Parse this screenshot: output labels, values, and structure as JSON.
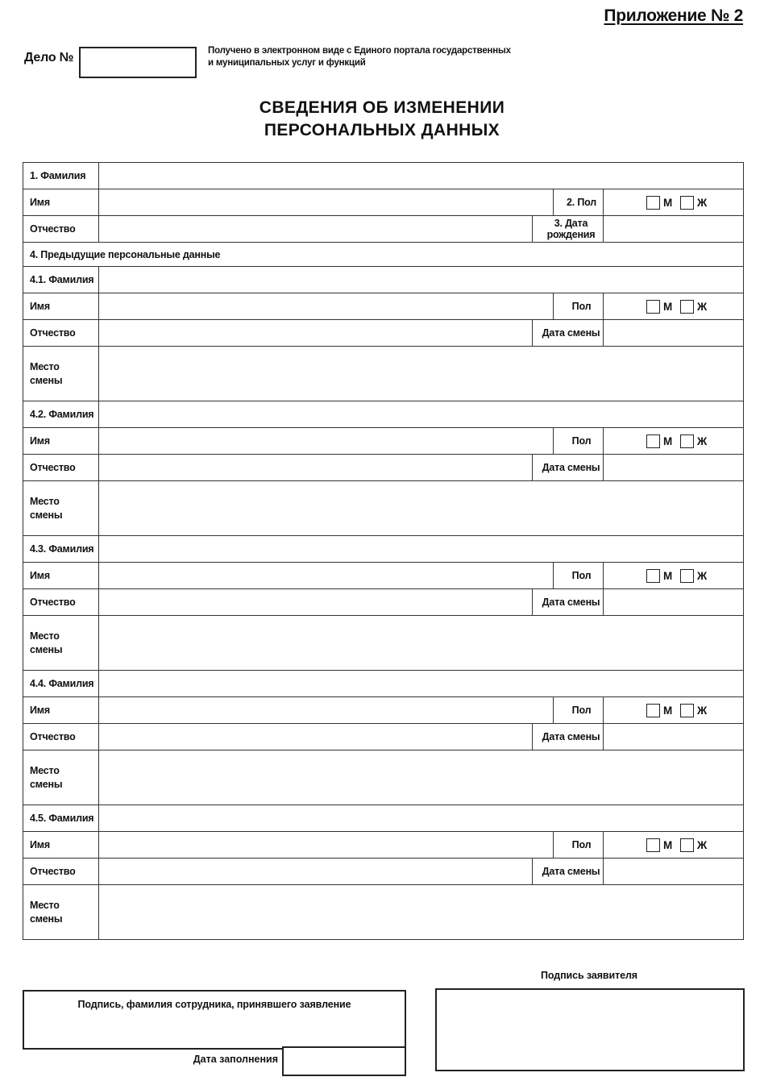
{
  "header": {
    "appendix": "Приложение № 2",
    "case_label": "Дело №",
    "case_value": "",
    "portal_note_line1": "Получено в электронном виде с Единого портала",
    "portal_note_line2": "государственных и муниципальных услуг и функций"
  },
  "title": {
    "line1": "СВЕДЕНИЯ ОБ ИЗМЕНЕНИИ",
    "line2": "ПЕРСОНАЛЬНЫХ ДАННЫХ"
  },
  "current": {
    "surname_label": "1. Фамилия",
    "surname_value": "",
    "firstname_label": "Имя",
    "firstname_value": "",
    "patronymic_label": "Отчество",
    "patronymic_value": "",
    "sex_label": "2. Пол",
    "sex_male": "М",
    "sex_female": "Ж",
    "dob_label": "3. Дата рождения",
    "dob_value": ""
  },
  "previous_section": {
    "heading": "4. Предыдущие персональные данные",
    "sex_label": "Пол",
    "sex_male": "М",
    "sex_female": "Ж",
    "date_change_label": "Дата смены",
    "firstname_label": "Имя",
    "patronymic_label": "Отчество",
    "place_label_line1": "Место",
    "place_label_line2": "смены",
    "blocks": [
      {
        "surname_label": "4.1. Фамилия",
        "surname_value": "",
        "firstname_value": "",
        "patronymic_value": "",
        "date_change_value": "",
        "place_value": ""
      },
      {
        "surname_label": "4.2. Фамилия",
        "surname_value": "",
        "firstname_value": "",
        "patronymic_value": "",
        "date_change_value": "",
        "place_value": ""
      },
      {
        "surname_label": "4.3. Фамилия",
        "surname_value": "",
        "firstname_value": "",
        "patronymic_value": "",
        "date_change_value": "",
        "place_value": ""
      },
      {
        "surname_label": "4.4. Фамилия",
        "surname_value": "",
        "firstname_value": "",
        "patronymic_value": "",
        "date_change_value": "",
        "place_value": ""
      },
      {
        "surname_label": "4.5. Фамилия",
        "surname_value": "",
        "firstname_value": "",
        "patronymic_value": "",
        "date_change_value": "",
        "place_value": ""
      }
    ]
  },
  "footer": {
    "staff_signature_label": "Подпись, фамилия сотрудника, принявшего заявление",
    "staff_signature_value": "",
    "fill_date_label": "Дата заполнения",
    "fill_date_value": "",
    "applicant_signature_label": "Подпись заявителя",
    "applicant_signature_value": ""
  }
}
